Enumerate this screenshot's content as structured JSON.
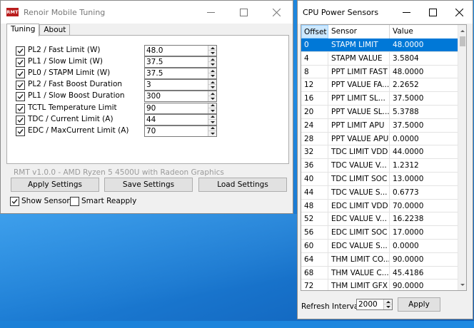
{
  "main_window": {
    "icon_text": "RMT",
    "title": "Renoir Mobile Tuning",
    "tabs": [
      {
        "label": "Tuning",
        "active": true
      },
      {
        "label": "About",
        "active": false
      }
    ],
    "params": [
      {
        "label": "PL2 / Fast Limit (W)",
        "value": "48.0",
        "checked": true
      },
      {
        "label": "PL1 / Slow Limit (W)",
        "value": "37.5",
        "checked": true
      },
      {
        "label": "PL0 / STAPM Limit (W)",
        "value": "37.5",
        "checked": true
      },
      {
        "label": "PL2 / Fast Boost Duration",
        "value": "3",
        "checked": true
      },
      {
        "label": "PL1 / Slow Boost Duration",
        "value": "300",
        "checked": true
      },
      {
        "label": "TCTL Temperature Limit",
        "value": "90",
        "checked": true
      },
      {
        "label": "TDC / Current Limit (A)",
        "value": "44",
        "checked": true
      },
      {
        "label": "EDC / MaxCurrent Limit (A)",
        "value": "70",
        "checked": true
      }
    ],
    "status": "RMT v1.0.0 - AMD Ryzen 5 4500U with Radeon Graphics",
    "buttons": {
      "apply": "Apply Settings",
      "save": "Save Settings",
      "load": "Load Settings"
    },
    "show_sensors": {
      "label": "Show Sensors",
      "checked": true
    },
    "smart_reapply": {
      "label": "Smart Reapply",
      "checked": false
    }
  },
  "sensor_window": {
    "title": "CPU Power Sensors",
    "columns": {
      "offset": "Offset",
      "sensor": "Sensor",
      "value": "Value"
    },
    "rows": [
      {
        "offset": "0",
        "sensor": "STAPM LIMIT",
        "value": "48.0000",
        "selected": true
      },
      {
        "offset": "4",
        "sensor": "STAPM VALUE",
        "value": "3.5804"
      },
      {
        "offset": "8",
        "sensor": "PPT LIMIT FAST",
        "value": "48.0000"
      },
      {
        "offset": "12",
        "sensor": "PPT VALUE FA...",
        "value": "2.2652"
      },
      {
        "offset": "16",
        "sensor": "PPT LIMIT SL...",
        "value": "37.5000"
      },
      {
        "offset": "20",
        "sensor": "PPT VALUE SL...",
        "value": "5.3788"
      },
      {
        "offset": "24",
        "sensor": "PPT LIMIT APU",
        "value": "37.5000"
      },
      {
        "offset": "28",
        "sensor": "PPT VALUE APU",
        "value": "0.0000"
      },
      {
        "offset": "32",
        "sensor": "TDC LIMIT VDD",
        "value": "44.0000"
      },
      {
        "offset": "36",
        "sensor": "TDC VALUE V...",
        "value": "1.2312"
      },
      {
        "offset": "40",
        "sensor": "TDC LIMIT SOC",
        "value": "13.0000"
      },
      {
        "offset": "44",
        "sensor": "TDC VALUE S...",
        "value": "0.6773"
      },
      {
        "offset": "48",
        "sensor": "EDC LIMIT VDD",
        "value": "70.0000"
      },
      {
        "offset": "52",
        "sensor": "EDC VALUE V...",
        "value": "16.2238"
      },
      {
        "offset": "56",
        "sensor": "EDC LIMIT SOC",
        "value": "17.0000"
      },
      {
        "offset": "60",
        "sensor": "EDC VALUE S...",
        "value": "0.0000"
      },
      {
        "offset": "64",
        "sensor": "THM LIMIT CO...",
        "value": "90.0000"
      },
      {
        "offset": "68",
        "sensor": "THM VALUE C...",
        "value": "45.4186"
      },
      {
        "offset": "72",
        "sensor": "THM LIMIT GFX",
        "value": "90.0000"
      }
    ],
    "refresh_label": "Refresh Interval",
    "refresh_value": "2000",
    "apply_label": "Apply"
  },
  "colors": {
    "selection": "#0078d7",
    "header_highlight": "#cce8ff",
    "desktop": "#1f8be3",
    "icon_bg": "#b91c1c"
  },
  "icons": [
    "app-logo-icon",
    "minimize-icon",
    "maximize-icon",
    "close-icon",
    "check-icon",
    "spin-up-icon",
    "spin-down-icon",
    "scroll-up-icon",
    "scroll-down-icon"
  ]
}
